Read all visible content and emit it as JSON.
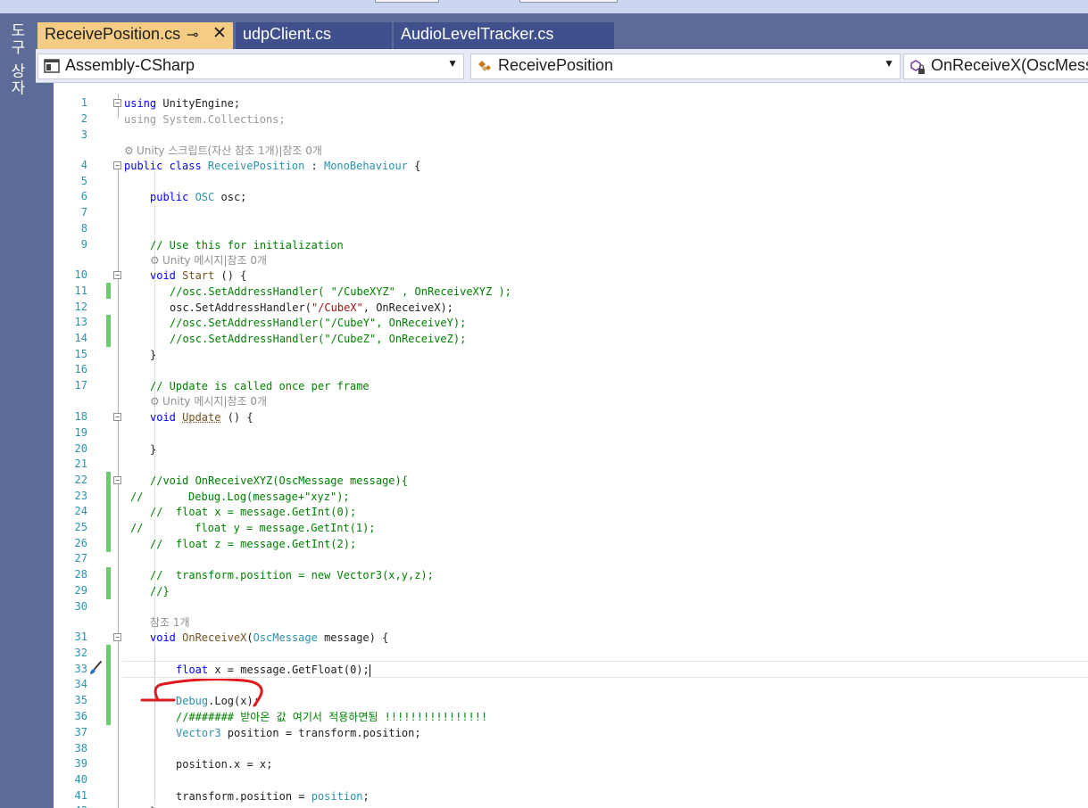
{
  "sidebar": {
    "label": "도구 상자"
  },
  "tabs": [
    {
      "label": "ReceivePosition.cs",
      "active": true,
      "pin_icon": "pin-icon",
      "close_icon": "close-icon"
    },
    {
      "label": "udpClient.cs",
      "active": false
    },
    {
      "label": "AudioLevelTracker.cs",
      "active": false
    }
  ],
  "navbar": {
    "project": {
      "label": "Assembly-CSharp",
      "icon": "csharp-project-icon"
    },
    "type": {
      "label": "ReceivePosition",
      "icon": "class-icon"
    },
    "member": {
      "label": "OnReceiveX(OscMess",
      "icon": "method-lock-icon"
    }
  },
  "colors": {
    "accent_tab": "#f5cc84",
    "frame": "#5d6b99",
    "change_bar": "#6ccc6c",
    "annotation": "#e0191d"
  },
  "code": {
    "lens_unity_script": "Unity 스크립트(자산 참조 1개)|참조 0개",
    "lens_unity_message": "Unity 메시지|참조 0개",
    "lens_references": "참조 1개",
    "l1a": "using",
    "l1b": " UnityEngine;",
    "l2": "using System.Collections;",
    "l4a": "public class ",
    "l4b": "ReceivePosition",
    "l4c": " : ",
    "l4d": "MonoBehaviour",
    "l4e": " {",
    "l6a": "public ",
    "l6b": "OSC",
    "l6c": " osc;",
    "l9": "// Use this for initialization",
    "l10a": "void ",
    "l10b": "Start",
    "l10c": " () {",
    "l11": "//osc.SetAddressHandler( \"/CubeXYZ\" , OnReceiveXYZ );",
    "l12a": "osc.SetAddressHandler(",
    "l12b": "\"/CubeX\"",
    "l12c": ", OnReceiveX);",
    "l13": "//osc.SetAddressHandler(\"/CubeY\", OnReceiveY);",
    "l14": "//osc.SetAddressHandler(\"/CubeZ\", OnReceiveZ);",
    "l15": "}",
    "l17": "// Update is called once per frame",
    "l18a": "void ",
    "l18b": "Update",
    "l18c": " () {",
    "l20": "}",
    "l22": "//void OnReceiveXYZ(OscMessage message){",
    "l23": "//       Debug.Log(message+\"xyz\");",
    "l24": "//  float x = message.GetInt(0);",
    "l25": "//        float y = message.GetInt(1);",
    "l26": "//  float z = message.GetInt(2);",
    "l28": "//  transform.position = new Vector3(x,y,z);",
    "l29": "//}",
    "l31a": "void ",
    "l31b": "OnReceiveX",
    "l31c": "(",
    "l31d": "OscMessage",
    "l31e": " message) {",
    "l33a": "float",
    "l33b": " x = message.GetFloat(0);",
    "l35a": "Debug",
    "l35b": ".Log(x);",
    "l36": "//####### 받아온 값 여기서 적용하면됨 !!!!!!!!!!!!!!!!",
    "l37a": "Vector3",
    "l37b": " position = transform.position;",
    "l39": "position.x = x;",
    "l41a": "transform.position = ",
    "l41b": "position",
    "l41c": ";",
    "l42": "}"
  }
}
